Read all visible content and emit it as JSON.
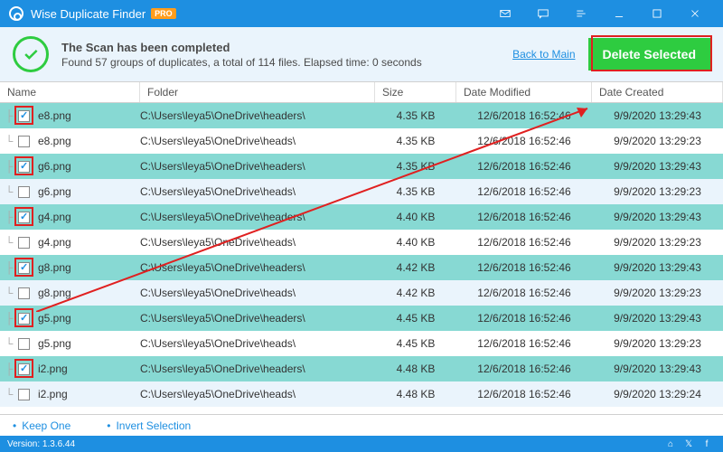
{
  "app": {
    "title": "Wise Duplicate Finder",
    "pro": "PRO"
  },
  "banner": {
    "title": "The Scan has been completed",
    "subtitle": "Found 57 groups of duplicates, a total of 114 files. Elapsed time: 0 seconds",
    "back": "Back to Main",
    "delete": "Delete Selected"
  },
  "cols": {
    "name": "Name",
    "folder": "Folder",
    "size": "Size",
    "mod": "Date Modified",
    "cre": "Date Created"
  },
  "rows": [
    {
      "checked": true,
      "hl": true,
      "name": "e8.png",
      "folder": "C:\\Users\\leya5\\OneDrive\\headers\\",
      "size": "4.35 KB",
      "mod": "12/6/2018 16:52:46",
      "cre": "9/9/2020 13:29:43",
      "cls": "sel",
      "tree": "├"
    },
    {
      "checked": false,
      "name": "e8.png",
      "folder": "C:\\Users\\leya5\\OneDrive\\heads\\",
      "size": "4.35 KB",
      "mod": "12/6/2018 16:52:46",
      "cre": "9/9/2020 13:29:23",
      "cls": "",
      "tree": "└"
    },
    {
      "checked": true,
      "hl": true,
      "name": "g6.png",
      "folder": "C:\\Users\\leya5\\OneDrive\\headers\\",
      "size": "4.35 KB",
      "mod": "12/6/2018 16:52:46",
      "cre": "9/9/2020 13:29:43",
      "cls": "sel",
      "tree": "├"
    },
    {
      "checked": false,
      "name": "g6.png",
      "folder": "C:\\Users\\leya5\\OneDrive\\heads\\",
      "size": "4.35 KB",
      "mod": "12/6/2018 16:52:46",
      "cre": "9/9/2020 13:29:23",
      "cls": "",
      "tree": "└"
    },
    {
      "checked": true,
      "hl": true,
      "name": "g4.png",
      "folder": "C:\\Users\\leya5\\OneDrive\\headers\\",
      "size": "4.40 KB",
      "mod": "12/6/2018 16:52:46",
      "cre": "9/9/2020 13:29:43",
      "cls": "sel",
      "tree": "├"
    },
    {
      "checked": false,
      "name": "g4.png",
      "folder": "C:\\Users\\leya5\\OneDrive\\heads\\",
      "size": "4.40 KB",
      "mod": "12/6/2018 16:52:46",
      "cre": "9/9/2020 13:29:23",
      "cls": "",
      "tree": "└"
    },
    {
      "checked": true,
      "hl": true,
      "name": "g8.png",
      "folder": "C:\\Users\\leya5\\OneDrive\\headers\\",
      "size": "4.42 KB",
      "mod": "12/6/2018 16:52:46",
      "cre": "9/9/2020 13:29:43",
      "cls": "sel",
      "tree": "├"
    },
    {
      "checked": false,
      "name": "g8.png",
      "folder": "C:\\Users\\leya5\\OneDrive\\heads\\",
      "size": "4.42 KB",
      "mod": "12/6/2018 16:52:46",
      "cre": "9/9/2020 13:29:23",
      "cls": "",
      "tree": "└"
    },
    {
      "checked": true,
      "hl": true,
      "name": "g5.png",
      "folder": "C:\\Users\\leya5\\OneDrive\\headers\\",
      "size": "4.45 KB",
      "mod": "12/6/2018 16:52:46",
      "cre": "9/9/2020 13:29:43",
      "cls": "sel",
      "tree": "├"
    },
    {
      "checked": false,
      "name": "g5.png",
      "folder": "C:\\Users\\leya5\\OneDrive\\heads\\",
      "size": "4.45 KB",
      "mod": "12/6/2018 16:52:46",
      "cre": "9/9/2020 13:29:23",
      "cls": "",
      "tree": "└"
    },
    {
      "checked": true,
      "hl": true,
      "name": "i2.png",
      "folder": "C:\\Users\\leya5\\OneDrive\\headers\\",
      "size": "4.48 KB",
      "mod": "12/6/2018 16:52:46",
      "cre": "9/9/2020 13:29:43",
      "cls": "sel",
      "tree": "├"
    },
    {
      "checked": false,
      "name": "i2.png",
      "folder": "C:\\Users\\leya5\\OneDrive\\heads\\",
      "size": "4.48 KB",
      "mod": "12/6/2018 16:52:46",
      "cre": "9/9/2020 13:29:24",
      "cls": "",
      "tree": "└"
    }
  ],
  "footer": {
    "keep": "Keep One",
    "invert": "Invert Selection"
  },
  "status": {
    "version": "Version: 1.3.6.44"
  }
}
